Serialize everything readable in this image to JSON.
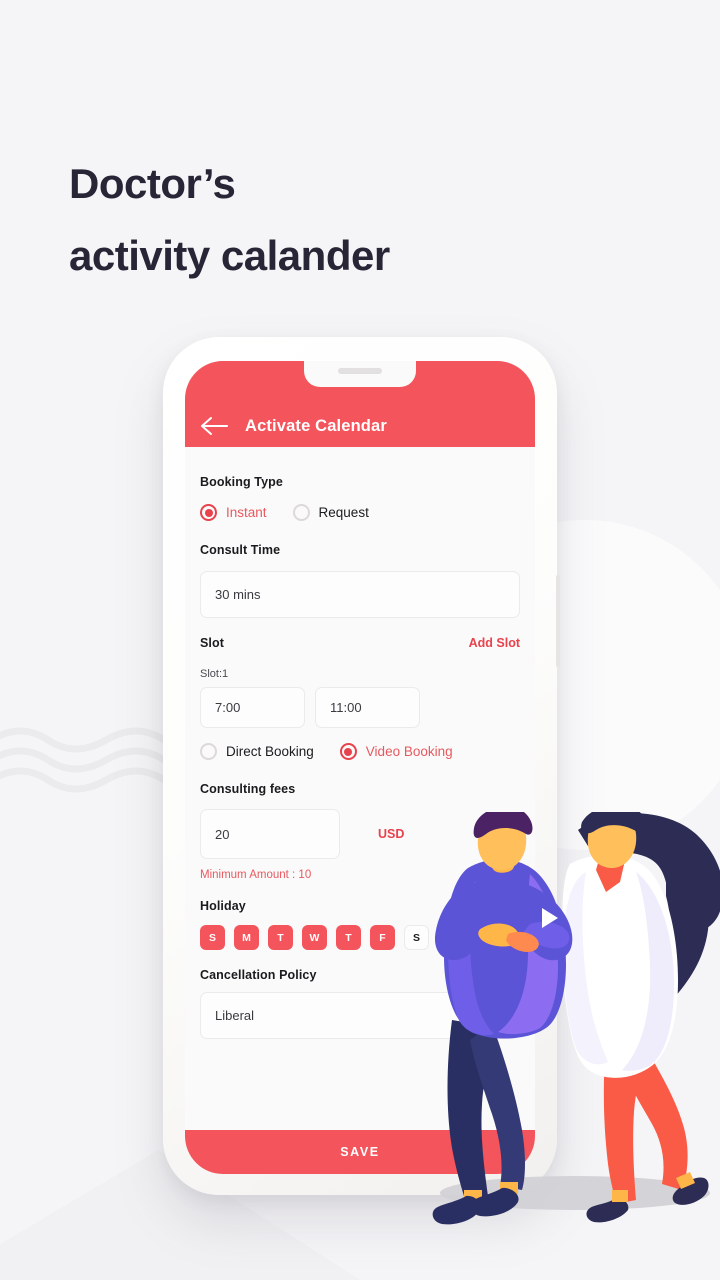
{
  "page": {
    "headline_line1": "Doctor’s",
    "headline_line2": "activity calander",
    "background_color": "#f5f5f7",
    "accent_color": "#F4545B",
    "heading_color": "#272536"
  },
  "phone": {
    "appbar": {
      "back_icon": "arrow-left-icon",
      "title": "Activate Calendar",
      "background_color": "#F4545B",
      "title_color": "#ffffff"
    },
    "form": {
      "booking_type": {
        "label": "Booking Type",
        "options": [
          {
            "label": "Instant",
            "selected": true
          },
          {
            "label": "Request",
            "selected": false
          }
        ]
      },
      "consult_time": {
        "label": "Consult Time",
        "value": "30 mins"
      },
      "slot": {
        "label": "Slot",
        "add_label": "Add Slot",
        "slot_index_label": "Slot:1",
        "start_time": "7:00",
        "end_time": "11:00",
        "mode_options": [
          {
            "label": "Direct Booking",
            "selected": false
          },
          {
            "label": "Video Booking",
            "selected": true
          }
        ]
      },
      "consulting_fees": {
        "label": "Consulting fees",
        "value": "20",
        "currency": "USD",
        "hint": "Minimum Amount : 10",
        "hint_color": "#E8595F"
      },
      "holiday": {
        "label": "Holiday",
        "days": [
          {
            "letter": "S",
            "selected": true
          },
          {
            "letter": "M",
            "selected": true
          },
          {
            "letter": "T",
            "selected": true
          },
          {
            "letter": "W",
            "selected": true
          },
          {
            "letter": "T",
            "selected": true
          },
          {
            "letter": "F",
            "selected": true
          },
          {
            "letter": "S",
            "selected": false
          }
        ]
      },
      "cancellation_policy": {
        "label": "Cancellation Policy",
        "value": "Liberal"
      },
      "save_button": "SAVE"
    }
  }
}
